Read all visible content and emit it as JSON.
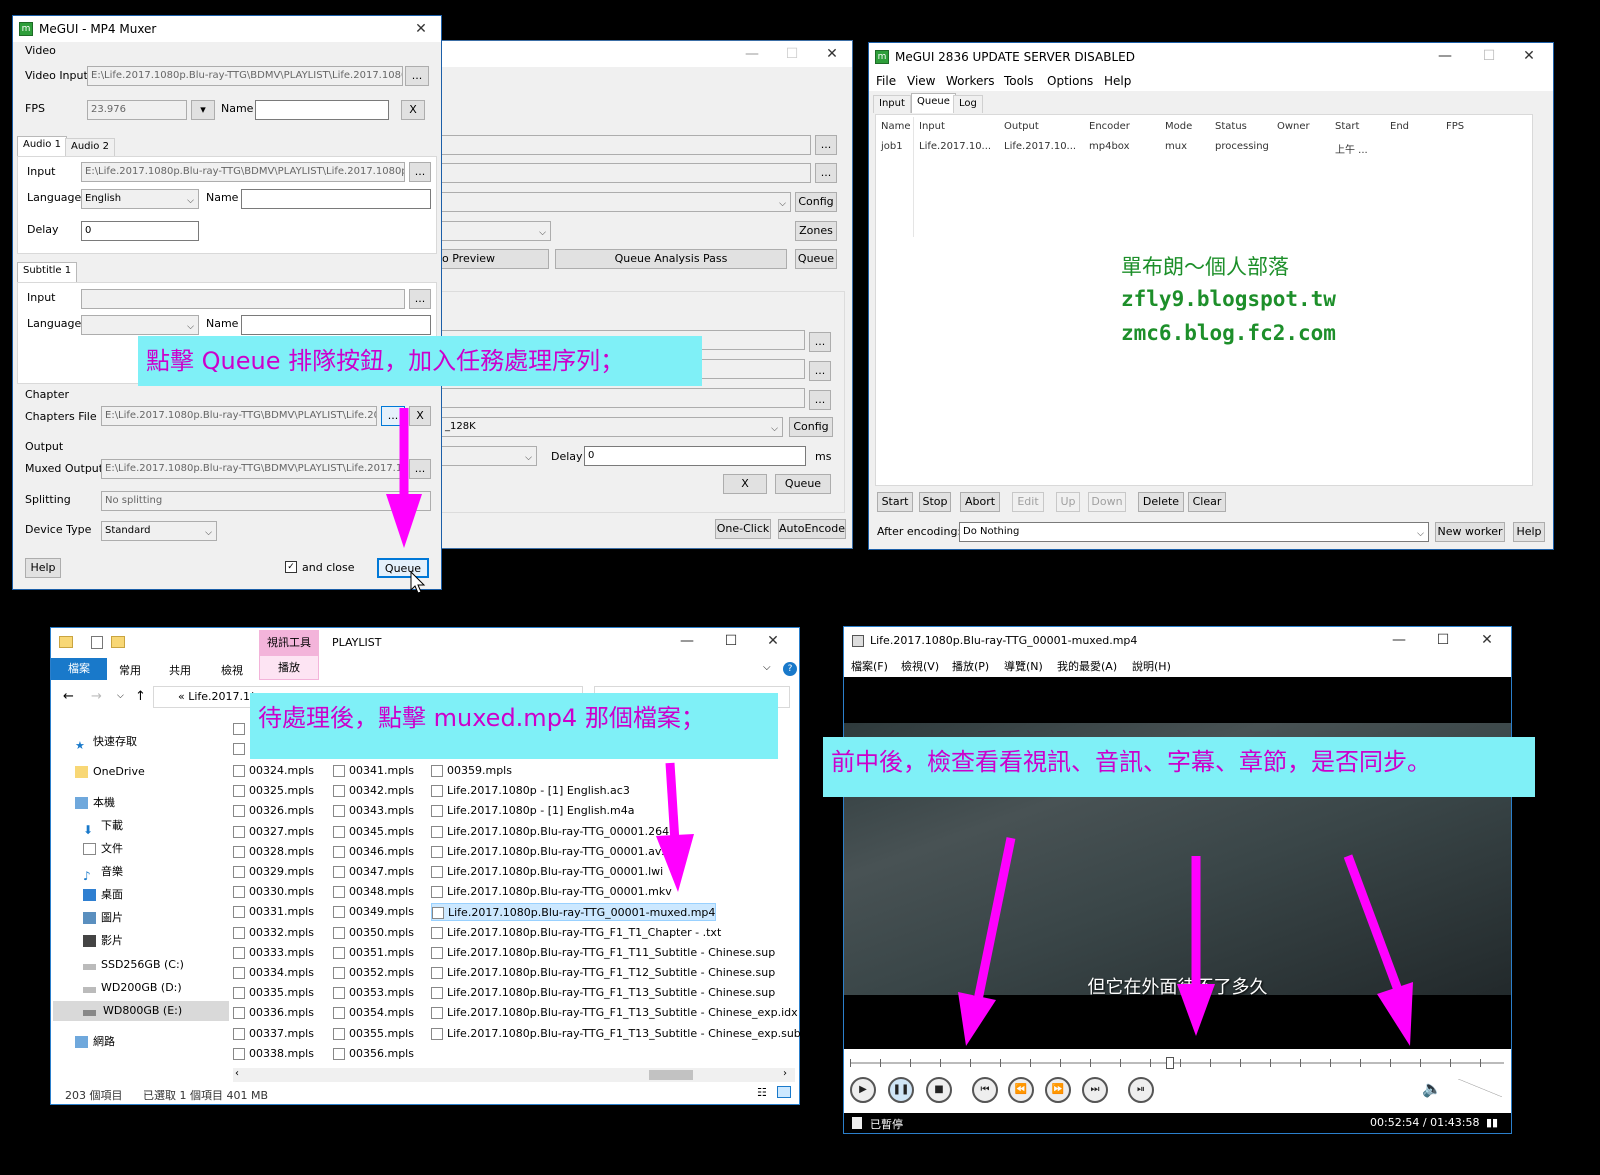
{
  "muxer": {
    "title": "MeGUI - MP4 Muxer",
    "video_group": "Video",
    "video_input_label": "Video Input",
    "video_input": "E:\\Life.2017.1080p.Blu-ray-TTG\\BDMV\\PLAYLIST\\Life.2017.1080p.",
    "fps_label": "FPS",
    "fps": "23.976",
    "name_label": "Name",
    "x": "X",
    "browse": "...",
    "audio_tabs": [
      "Audio 1",
      "Audio 2"
    ],
    "input_label": "Input",
    "audio_input": "E:\\Life.2017.1080p.Blu-ray-TTG\\BDMV\\PLAYLIST\\Life.2017.1080p - [",
    "language_label": "Language",
    "language": "English",
    "delay_label": "Delay",
    "delay": "0",
    "subtitle_tab": "Subtitle 1",
    "chapter_group": "Chapter",
    "chapters_file_label": "Chapters File",
    "chapters_file": "E:\\Life.2017.1080p.Blu-ray-TTG\\BDMV\\PLAYLIST\\Life.2017",
    "output_group": "Output",
    "muxed_output_label": "Muxed Output",
    "muxed_output": "E:\\Life.2017.1080p.Blu-ray-TTG\\BDMV\\PLAYLIST\\Life.2017.1080",
    "splitting_label": "Splitting",
    "splitting": "No splitting",
    "device_type_label": "Device Type",
    "device_type": "Standard",
    "help": "Help",
    "and_close": "and close",
    "queue": "Queue"
  },
  "bgwin": {
    "preview": "o Preview",
    "queue_analysis": "Queue Analysis Pass",
    "queue": "Queue",
    "config": "Config",
    "zones": "Zones",
    "audio_preset": "_128K",
    "delay_label": "Delay",
    "delay": "0",
    "ms": "ms",
    "x": "X",
    "one_click": "One-Click",
    "auto_encode": "AutoEncode"
  },
  "megui": {
    "title": "MeGUI 2836 UPDATE SERVER DISABLED",
    "menu": [
      "File",
      "View",
      "Workers",
      "Tools",
      "Options",
      "Help"
    ],
    "tabs": [
      "Input",
      "Queue",
      "Log"
    ],
    "columns": [
      "Name",
      "Input",
      "Output",
      "Encoder",
      "Mode",
      "Status",
      "Owner",
      "Start",
      "End",
      "FPS"
    ],
    "row": [
      "job1",
      "Life.2017.10...",
      "Life.2017.10...",
      "mp4box",
      "mux",
      "processing",
      "",
      "上午 ...",
      "",
      ""
    ],
    "watermark": [
      "單布朗～個人部落",
      "zfly9.blogspot.tw",
      "zmc6.blog.fc2.com"
    ],
    "buttons": [
      "Start",
      "Stop",
      "Abort",
      "Edit",
      "Up",
      "Down",
      "Delete",
      "Clear"
    ],
    "after_encoding_label": "After encoding:",
    "after_encoding": "Do Nothing",
    "new_worker": "New worker",
    "help": "Help"
  },
  "explorer": {
    "ribbon_context": "視訊工具",
    "title": "PLAYLIST",
    "ribbon_tabs": [
      "檔案",
      "常用",
      "共用",
      "檢視",
      "播放"
    ],
    "address": "Life.2017.1(",
    "nav": [
      "快速存取",
      "OneDrive",
      "本機",
      "下載",
      "文件",
      "音樂",
      "桌面",
      "圖片",
      "影片",
      "SSD256GB (C:)",
      "WD200GB (D:)",
      "WD800GB (E:)",
      "網路"
    ],
    "col1": [
      "00324.mpls",
      "00325.mpls",
      "00326.mpls",
      "00327.mpls",
      "00328.mpls",
      "00329.mpls",
      "00330.mpls",
      "00331.mpls",
      "00332.mpls",
      "00333.mpls",
      "00334.mpls",
      "00335.mpls",
      "00336.mpls",
      "00337.mpls",
      "00338.mpls"
    ],
    "col2": [
      "00341.mpls",
      "00342.mpls",
      "00343.mpls",
      "00345.mpls",
      "00346.mpls",
      "00347.mpls",
      "00348.mpls",
      "00349.mpls",
      "00350.mpls",
      "00351.mpls",
      "00352.mpls",
      "00353.mpls",
      "00354.mpls",
      "00355.mpls",
      "00356.mpls"
    ],
    "col3": [
      "00359.mpls",
      "Life.2017.1080p - [1] English.ac3",
      "Life.2017.1080p - [1] English.m4a",
      "Life.2017.1080p.Blu-ray-TTG_00001.264",
      "Life.2017.1080p.Blu-ray-TTG_00001.avs",
      "Life.2017.1080p.Blu-ray-TTG_00001.lwi",
      "Life.2017.1080p.Blu-ray-TTG_00001.mkv",
      "Life.2017.1080p.Blu-ray-TTG_00001-muxed.mp4",
      "Life.2017.1080p.Blu-ray-TTG_F1_T1_Chapter - .txt",
      "Life.2017.1080p.Blu-ray-TTG_F1_T11_Subtitle - Chinese.sup",
      "Life.2017.1080p.Blu-ray-TTG_F1_T12_Subtitle - Chinese.sup",
      "Life.2017.1080p.Blu-ray-TTG_F1_T13_Subtitle - Chinese.sup",
      "Life.2017.1080p.Blu-ray-TTG_F1_T13_Subtitle - Chinese_exp.idx",
      "Life.2017.1080p.Blu-ray-TTG_F1_T13_Subtitle - Chinese_exp.sub"
    ],
    "status_count": "203 個項目",
    "status_selected": "已選取 1 個項目  401 MB"
  },
  "player": {
    "title": "Life.2017.1080p.Blu-ray-TTG_00001-muxed.mp4",
    "menu": [
      "檔案(F)",
      "檢視(V)",
      "播放(P)",
      "導覽(N)",
      "我的最愛(A)",
      "說明(H)"
    ],
    "subtitle": "但它在外面待不了多久",
    "status": "已暫停",
    "time": "00:52:54 / 01:43:58",
    "progress": 0.49
  },
  "callouts": {
    "c1": "點擊 Queue 排隊按鈕，加入任務處理序列；",
    "c2": "待處理後，點擊 muxed.mp4 那個檔案；",
    "c3": "前中後，檢查看看視訊、音訊、字幕、章節，是否同步。"
  },
  "colors": {
    "callout_bg": "#7ff0f7",
    "callout_text": "#cc00cc",
    "arrow": "#ff00ff",
    "watermark": "#1d8f2a"
  }
}
